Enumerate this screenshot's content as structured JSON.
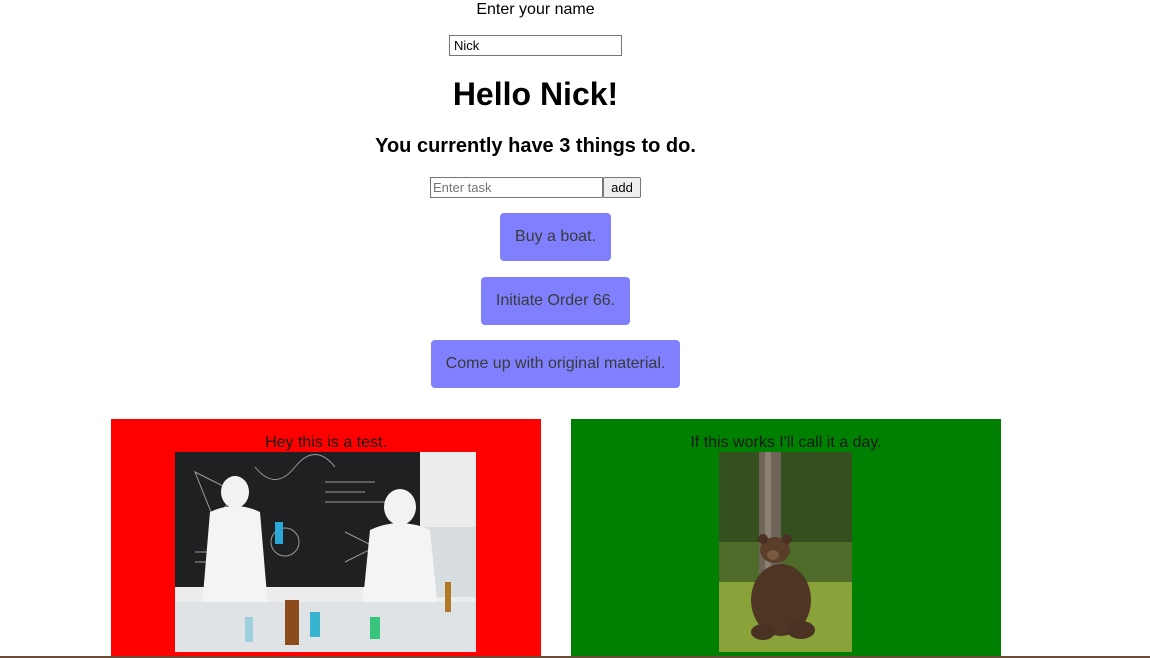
{
  "name_prompt": {
    "label": "Enter your name",
    "value": "Nick"
  },
  "greeting": "Hello Nick!",
  "task_count_text": "You currently have 3 things to do.",
  "task_form": {
    "placeholder": "Enter task",
    "add_label": "add"
  },
  "todos": [
    {
      "text": "Buy a boat."
    },
    {
      "text": "Initiate Order 66."
    },
    {
      "text": "Come up with original material."
    }
  ],
  "cards": [
    {
      "caption": "Hey this is a test.",
      "image": "laboratory-scientists-photo",
      "background": "#ff0000"
    },
    {
      "caption": "If this works I'll call it a day.",
      "image": "brown-bear-photo",
      "background": "#008000"
    }
  ],
  "colors": {
    "todo_bg": "#8080ff",
    "card_red": "#ff0000",
    "card_green": "#008000"
  }
}
